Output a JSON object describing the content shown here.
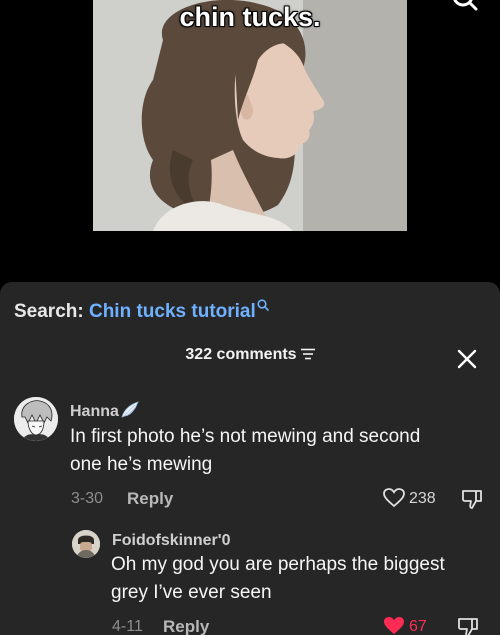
{
  "video": {
    "caption": "chin tucks."
  },
  "search": {
    "label": "Search:",
    "query": "Chin tucks tutorial"
  },
  "comments_header": {
    "count_label": "322 comments"
  },
  "comments": [
    {
      "author": "Hanna",
      "text_line1": "In first photo he’s not mewing and second",
      "text_line2": "one he’s mewing",
      "date": "3-30",
      "reply_label": "Reply",
      "likes": "238",
      "liked": false
    },
    {
      "author": "Foidofskinner'0",
      "text_line1": "Oh my god you are perhaps the biggest",
      "text_line2": "grey I’ve ever seen",
      "date": "4-11",
      "reply_label": "Reply",
      "likes": "67",
      "liked": true
    }
  ],
  "colors": {
    "panel_bg": "#262626",
    "query_link": "#6fb1ff",
    "like_active": "#fe2c55"
  },
  "icons": [
    "search-icon",
    "filter-icon",
    "close-icon",
    "angel-wing-icon",
    "heart-icon",
    "dislike-icon"
  ]
}
